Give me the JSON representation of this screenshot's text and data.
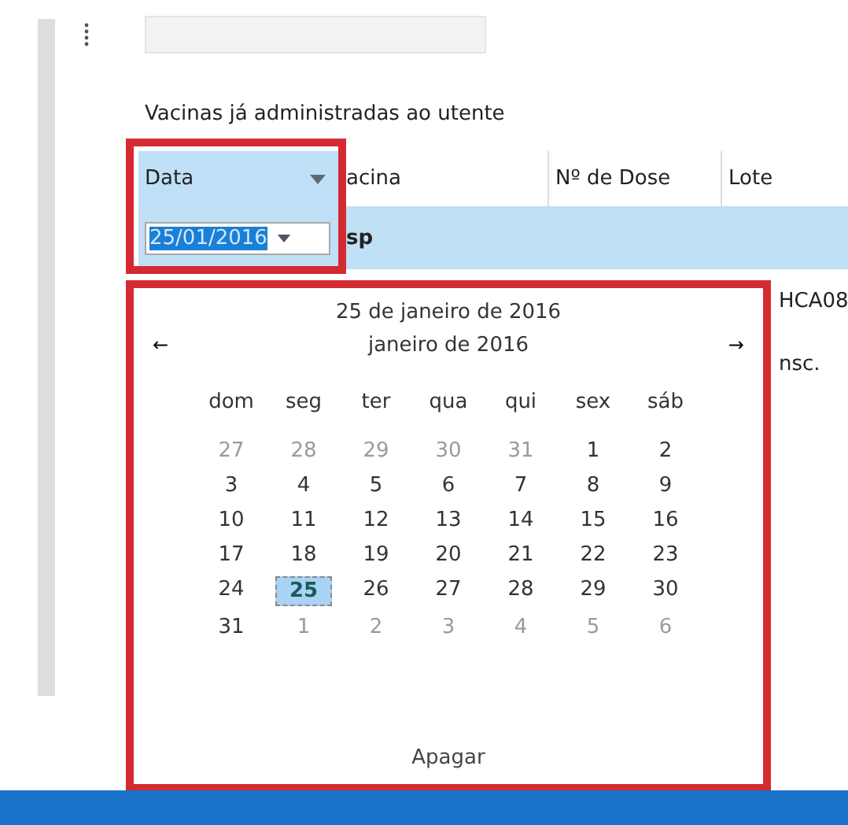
{
  "section_title": "Vacinas já administradas ao utente",
  "table": {
    "columns": [
      {
        "label": "Data",
        "selected": true
      },
      {
        "label": "acina",
        "selected": false
      },
      {
        "label": "Nº de Dose",
        "selected": false
      },
      {
        "label": "Lote",
        "selected": false
      }
    ],
    "date_editor": {
      "value": "25/01/2016"
    },
    "rows": [
      {
        "vacina": "sp",
        "selected": true
      },
      {
        "lote": "HCA08",
        "selected": false
      },
      {
        "lote": "nsc.",
        "selected": false
      }
    ]
  },
  "calendar": {
    "today": "25 de janeiro de 2016",
    "month": "janeiro de 2016",
    "prev": "←",
    "next": "→",
    "weekdays": [
      "dom",
      "seg",
      "ter",
      "qua",
      "qui",
      "sex",
      "sáb"
    ],
    "days": [
      {
        "label": "27",
        "other_month": true,
        "selected": false
      },
      {
        "label": "28",
        "other_month": true,
        "selected": false
      },
      {
        "label": "29",
        "other_month": true,
        "selected": false
      },
      {
        "label": "30",
        "other_month": true,
        "selected": false
      },
      {
        "label": "31",
        "other_month": true,
        "selected": false
      },
      {
        "label": "1",
        "other_month": false,
        "selected": false
      },
      {
        "label": "2",
        "other_month": false,
        "selected": false
      },
      {
        "label": "3",
        "other_month": false,
        "selected": false
      },
      {
        "label": "4",
        "other_month": false,
        "selected": false
      },
      {
        "label": "5",
        "other_month": false,
        "selected": false
      },
      {
        "label": "6",
        "other_month": false,
        "selected": false
      },
      {
        "label": "7",
        "other_month": false,
        "selected": false
      },
      {
        "label": "8",
        "other_month": false,
        "selected": false
      },
      {
        "label": "9",
        "other_month": false,
        "selected": false
      },
      {
        "label": "10",
        "other_month": false,
        "selected": false
      },
      {
        "label": "11",
        "other_month": false,
        "selected": false
      },
      {
        "label": "12",
        "other_month": false,
        "selected": false
      },
      {
        "label": "13",
        "other_month": false,
        "selected": false
      },
      {
        "label": "14",
        "other_month": false,
        "selected": false
      },
      {
        "label": "15",
        "other_month": false,
        "selected": false
      },
      {
        "label": "16",
        "other_month": false,
        "selected": false
      },
      {
        "label": "17",
        "other_month": false,
        "selected": false
      },
      {
        "label": "18",
        "other_month": false,
        "selected": false
      },
      {
        "label": "19",
        "other_month": false,
        "selected": false
      },
      {
        "label": "20",
        "other_month": false,
        "selected": false
      },
      {
        "label": "21",
        "other_month": false,
        "selected": false
      },
      {
        "label": "22",
        "other_month": false,
        "selected": false
      },
      {
        "label": "23",
        "other_month": false,
        "selected": false
      },
      {
        "label": "24",
        "other_month": false,
        "selected": false
      },
      {
        "label": "25",
        "other_month": false,
        "selected": true
      },
      {
        "label": "26",
        "other_month": false,
        "selected": false
      },
      {
        "label": "27",
        "other_month": false,
        "selected": false
      },
      {
        "label": "28",
        "other_month": false,
        "selected": false
      },
      {
        "label": "29",
        "other_month": false,
        "selected": false
      },
      {
        "label": "30",
        "other_month": false,
        "selected": false
      },
      {
        "label": "31",
        "other_month": false,
        "selected": false
      },
      {
        "label": "1",
        "other_month": true,
        "selected": false
      },
      {
        "label": "2",
        "other_month": true,
        "selected": false
      },
      {
        "label": "3",
        "other_month": true,
        "selected": false
      },
      {
        "label": "4",
        "other_month": true,
        "selected": false
      },
      {
        "label": "5",
        "other_month": true,
        "selected": false
      },
      {
        "label": "6",
        "other_month": true,
        "selected": false
      }
    ],
    "clear_button": "Apagar"
  }
}
